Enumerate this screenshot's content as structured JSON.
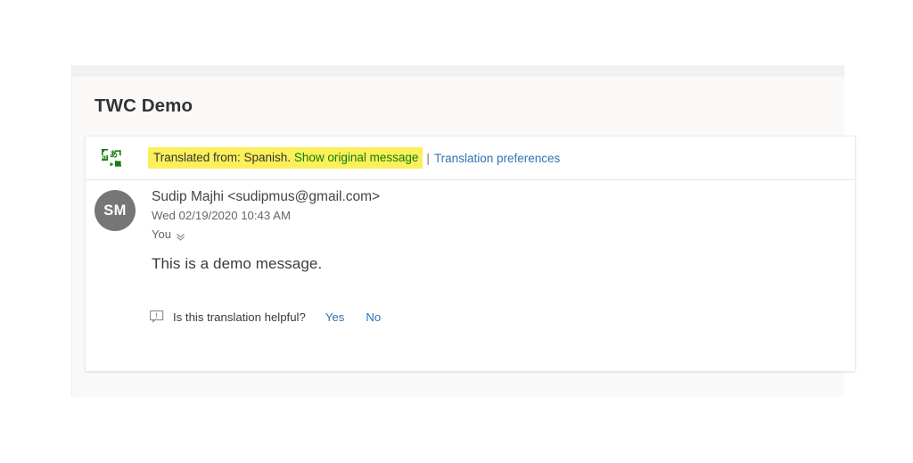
{
  "panel": {
    "subject": "TWC Demo"
  },
  "translation_banner": {
    "icon": "translate-icon",
    "translated_from_text": "Translated from: Spanish.",
    "show_original_label": "Show original message",
    "separator": "|",
    "preferences_link": "Translation preferences",
    "highlight_color": "#fbf05a",
    "show_original_color": "#107c10",
    "link_color": "#2e75b6"
  },
  "message": {
    "avatar_initials": "SM",
    "avatar_color": "#767676",
    "sender": "Sudip Majhi <sudipmus@gmail.com>",
    "timestamp": "Wed 02/19/2020 10:43 AM",
    "recipients": "You",
    "expand_icon": "chevron-double-down-icon",
    "body": "This is a demo message."
  },
  "feedback": {
    "icon": "feedback-bubble-icon",
    "question": "Is this translation helpful?",
    "yes_label": "Yes",
    "no_label": "No",
    "link_color": "#2e75b6"
  }
}
